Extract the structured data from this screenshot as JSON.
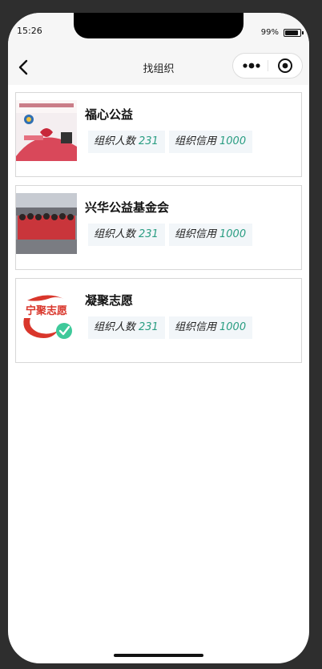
{
  "status_bar": {
    "time": "15:26",
    "battery": "99%"
  },
  "nav": {
    "title": "找组织"
  },
  "organizations": [
    {
      "name": "福心公益",
      "members_label": "组织人数",
      "members": "231",
      "credit_label": "组织信用",
      "credit": "1000"
    },
    {
      "name": "兴华公益基金会",
      "members_label": "组织人数",
      "members": "231",
      "credit_label": "组织信用",
      "credit": "1000"
    },
    {
      "name": "凝聚志愿",
      "members_label": "组织人数",
      "members": "231",
      "credit_label": "组织信用",
      "credit": "1000"
    }
  ],
  "thumbnails": {
    "first_logo_text": "宁聚志愿",
    "colors": {
      "accent": "#2a9d82",
      "brand_red": "#d9362b",
      "badge_green": "#3ec99a"
    }
  }
}
